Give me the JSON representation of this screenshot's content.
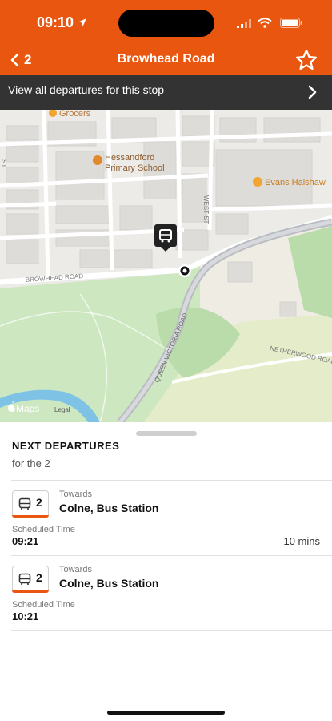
{
  "status": {
    "time": "09:10"
  },
  "nav": {
    "back_label": "2",
    "title": "Browhead Road"
  },
  "departures_bar": {
    "label": "View all departures for this stop"
  },
  "map": {
    "labels": {
      "grocers": "Grocers",
      "school_1": "Hessandford",
      "school_2": "Primary School",
      "evans": "Evans Halshaw",
      "west_st": "WEST ST",
      "st_left": "ST",
      "browhead": "BROWHEAD ROAD",
      "queen_victoria": "QUEEN VICTORIA ROAD",
      "netherwood": "NETHERWOOD ROAD",
      "maps": "Maps",
      "legal": "Legal"
    }
  },
  "next_departures": {
    "title": "NEXT DEPARTURES",
    "subtitle": "for the 2"
  },
  "departures": [
    {
      "route": "2",
      "towards_label": "Towards",
      "destination": "Colne, Bus Station",
      "scheduled_label": "Scheduled Time",
      "time": "09:21",
      "due": "10 mins"
    },
    {
      "route": "2",
      "towards_label": "Towards",
      "destination": "Colne, Bus Station",
      "scheduled_label": "Scheduled Time",
      "time": "10:21",
      "due": ""
    }
  ],
  "colors": {
    "brand": "#e8560f",
    "bar": "#333333"
  }
}
